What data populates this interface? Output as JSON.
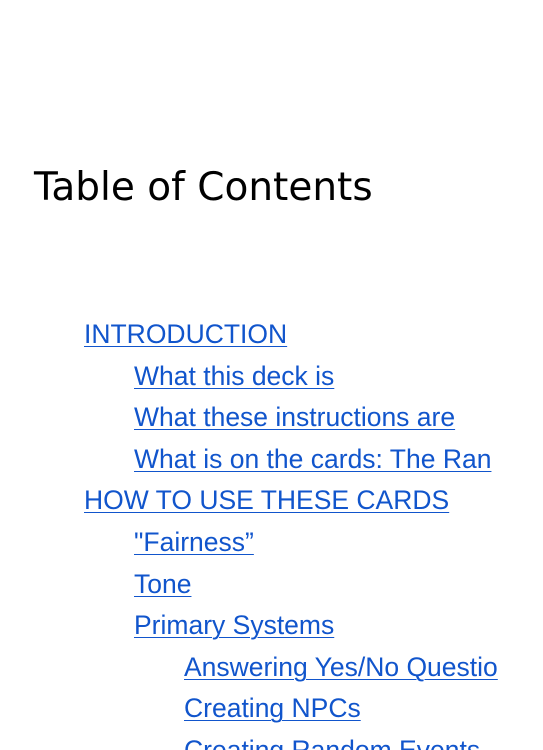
{
  "document": {
    "title": "Table of Contents"
  },
  "toc": {
    "entries": [
      {
        "label": "INTRODUCTION",
        "level": 1
      },
      {
        "label": "What this deck is",
        "level": 2
      },
      {
        "label": "What these instructions are",
        "level": 2
      },
      {
        "label": "What is on the cards: The Ran",
        "level": 2
      },
      {
        "label": "HOW TO USE THESE CARDS",
        "level": 1
      },
      {
        "label": "\"Fairness”",
        "level": 2
      },
      {
        "label": "Tone",
        "level": 2
      },
      {
        "label": "Primary Systems",
        "level": 2
      },
      {
        "label": "Answering Yes/No Questio",
        "level": 3
      },
      {
        "label": "Creating NPCs",
        "level": 3
      },
      {
        "label": "Creating Random Events",
        "level": 3
      }
    ]
  }
}
